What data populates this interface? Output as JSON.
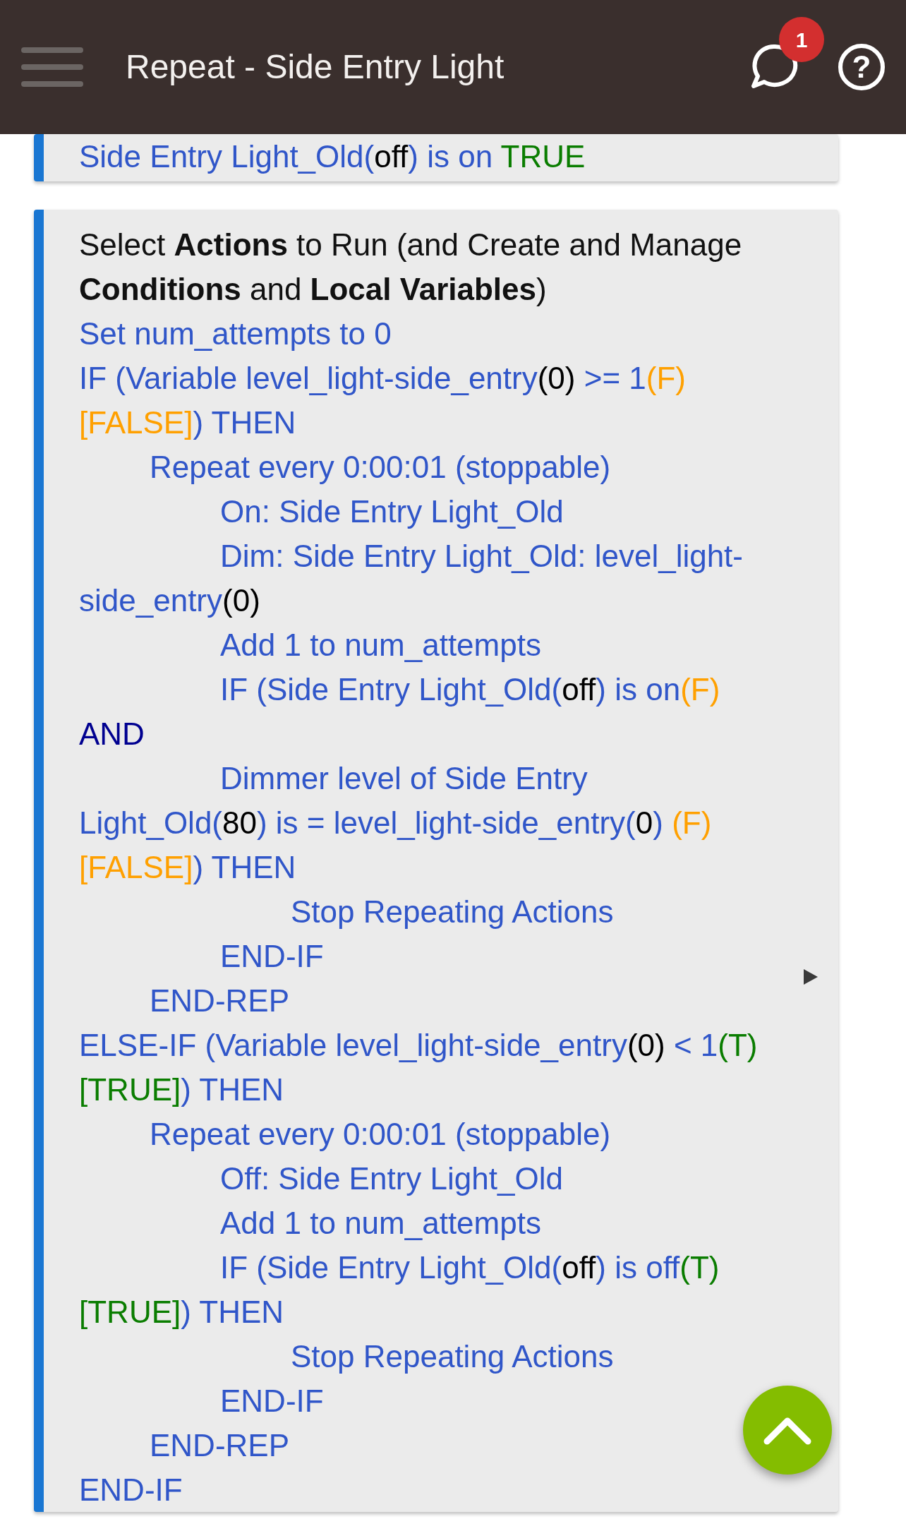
{
  "header": {
    "title": "Repeat - Side Entry Light",
    "notification_count": "1",
    "help": "?"
  },
  "previous_card": {
    "lines": [
      [
        {
          "text": "Side Entry Light_Old(",
          "kind": "code"
        },
        {
          "text": "off",
          "kind": "value"
        },
        {
          "text": ") is on ",
          "kind": "code"
        },
        {
          "text": "TRUE",
          "kind": "true"
        }
      ]
    ]
  },
  "actions_card": {
    "heading": "Select **Actions** to Run (and Create and Manage **Conditions** and **Local Variables**)",
    "statements": [
      {
        "lines": [
          [
            {
              "text": "Set num_attempts to 0",
              "kind": "code"
            }
          ]
        ]
      },
      {
        "lines": [
          [
            {
              "text": "IF (Variable level_light-side_entry",
              "kind": "code"
            },
            {
              "text": "(0)",
              "kind": "value"
            },
            {
              "text": " >= 1",
              "kind": "code"
            },
            {
              "text": "(F) [FALSE]",
              "kind": "false"
            },
            {
              "text": ") THEN",
              "kind": "code"
            }
          ]
        ],
        "children": [
          {
            "lines": [
              [
                {
                  "text": "Repeat every 0:00:01 (stoppable)",
                  "kind": "code"
                }
              ]
            ],
            "children": [
              {
                "lines": [
                  [
                    {
                      "text": "On: Side Entry Light_Old",
                      "kind": "code"
                    }
                  ]
                ]
              },
              {
                "lines": [
                  [
                    {
                      "text": "Dim: Side Entry Light_Old: level_light-side_entry",
                      "kind": "code"
                    },
                    {
                      "text": "(0)",
                      "kind": "value"
                    }
                  ]
                ]
              },
              {
                "lines": [
                  [
                    {
                      "text": "Add 1 to num_attempts",
                      "kind": "code"
                    }
                  ]
                ]
              },
              {
                "lines": [
                  [
                    {
                      "text": "IF (Side Entry Light_Old(",
                      "kind": "code"
                    },
                    {
                      "text": "off",
                      "kind": "value"
                    },
                    {
                      "text": ") is on",
                      "kind": "code"
                    },
                    {
                      "text": "(F)",
                      "kind": "false"
                    }
                  ],
                  [
                    {
                      "text": "AND",
                      "kind": "operator"
                    }
                  ],
                  [
                    {
                      "text": "Dimmer level of Side Entry Light_Old(",
                      "kind": "code"
                    },
                    {
                      "text": "80",
                      "kind": "value"
                    },
                    {
                      "text": ") is = level_light-side_entry(",
                      "kind": "code"
                    },
                    {
                      "text": "0",
                      "kind": "value"
                    },
                    {
                      "text": ")",
                      "kind": "code"
                    },
                    {
                      "text": " (F) [FALSE]",
                      "kind": "false"
                    },
                    {
                      "text": ") THEN",
                      "kind": "code"
                    }
                  ]
                ],
                "children": [
                  {
                    "lines": [
                      [
                        {
                          "text": "Stop Repeating Actions",
                          "kind": "code"
                        }
                      ]
                    ]
                  }
                ]
              },
              {
                "lines": [
                  [
                    {
                      "text": "END-IF",
                      "kind": "code"
                    }
                  ]
                ]
              }
            ]
          },
          {
            "lines": [
              [
                {
                  "text": "END-REP",
                  "kind": "code"
                }
              ]
            ]
          }
        ]
      },
      {
        "lines": [
          [
            {
              "text": "ELSE-IF (Variable level_light-side_entry",
              "kind": "code"
            },
            {
              "text": "(0)",
              "kind": "value"
            },
            {
              "text": " < 1",
              "kind": "code"
            },
            {
              "text": "(T) [TRUE]",
              "kind": "true"
            },
            {
              "text": ") THEN",
              "kind": "code"
            }
          ]
        ],
        "children": [
          {
            "lines": [
              [
                {
                  "text": "Repeat every 0:00:01 (stoppable)",
                  "kind": "code"
                }
              ]
            ],
            "children": [
              {
                "lines": [
                  [
                    {
                      "text": "Off: Side Entry Light_Old",
                      "kind": "code"
                    }
                  ]
                ]
              },
              {
                "lines": [
                  [
                    {
                      "text": "Add 1 to num_attempts",
                      "kind": "code"
                    }
                  ]
                ]
              },
              {
                "lines": [
                  [
                    {
                      "text": "IF (Side Entry Light_Old(",
                      "kind": "code"
                    },
                    {
                      "text": "off",
                      "kind": "value"
                    },
                    {
                      "text": ") is off",
                      "kind": "code"
                    },
                    {
                      "text": "(T) [TRUE]",
                      "kind": "true"
                    },
                    {
                      "text": ") THEN",
                      "kind": "code"
                    }
                  ]
                ],
                "children": [
                  {
                    "lines": [
                      [
                        {
                          "text": "Stop Repeating Actions",
                          "kind": "code"
                        }
                      ]
                    ]
                  }
                ]
              },
              {
                "lines": [
                  [
                    {
                      "text": "END-IF",
                      "kind": "code"
                    }
                  ]
                ]
              }
            ]
          },
          {
            "lines": [
              [
                {
                  "text": "END-REP",
                  "kind": "code"
                }
              ]
            ]
          }
        ]
      },
      {
        "lines": [
          [
            {
              "text": "END-IF",
              "kind": "code"
            }
          ]
        ]
      }
    ]
  }
}
